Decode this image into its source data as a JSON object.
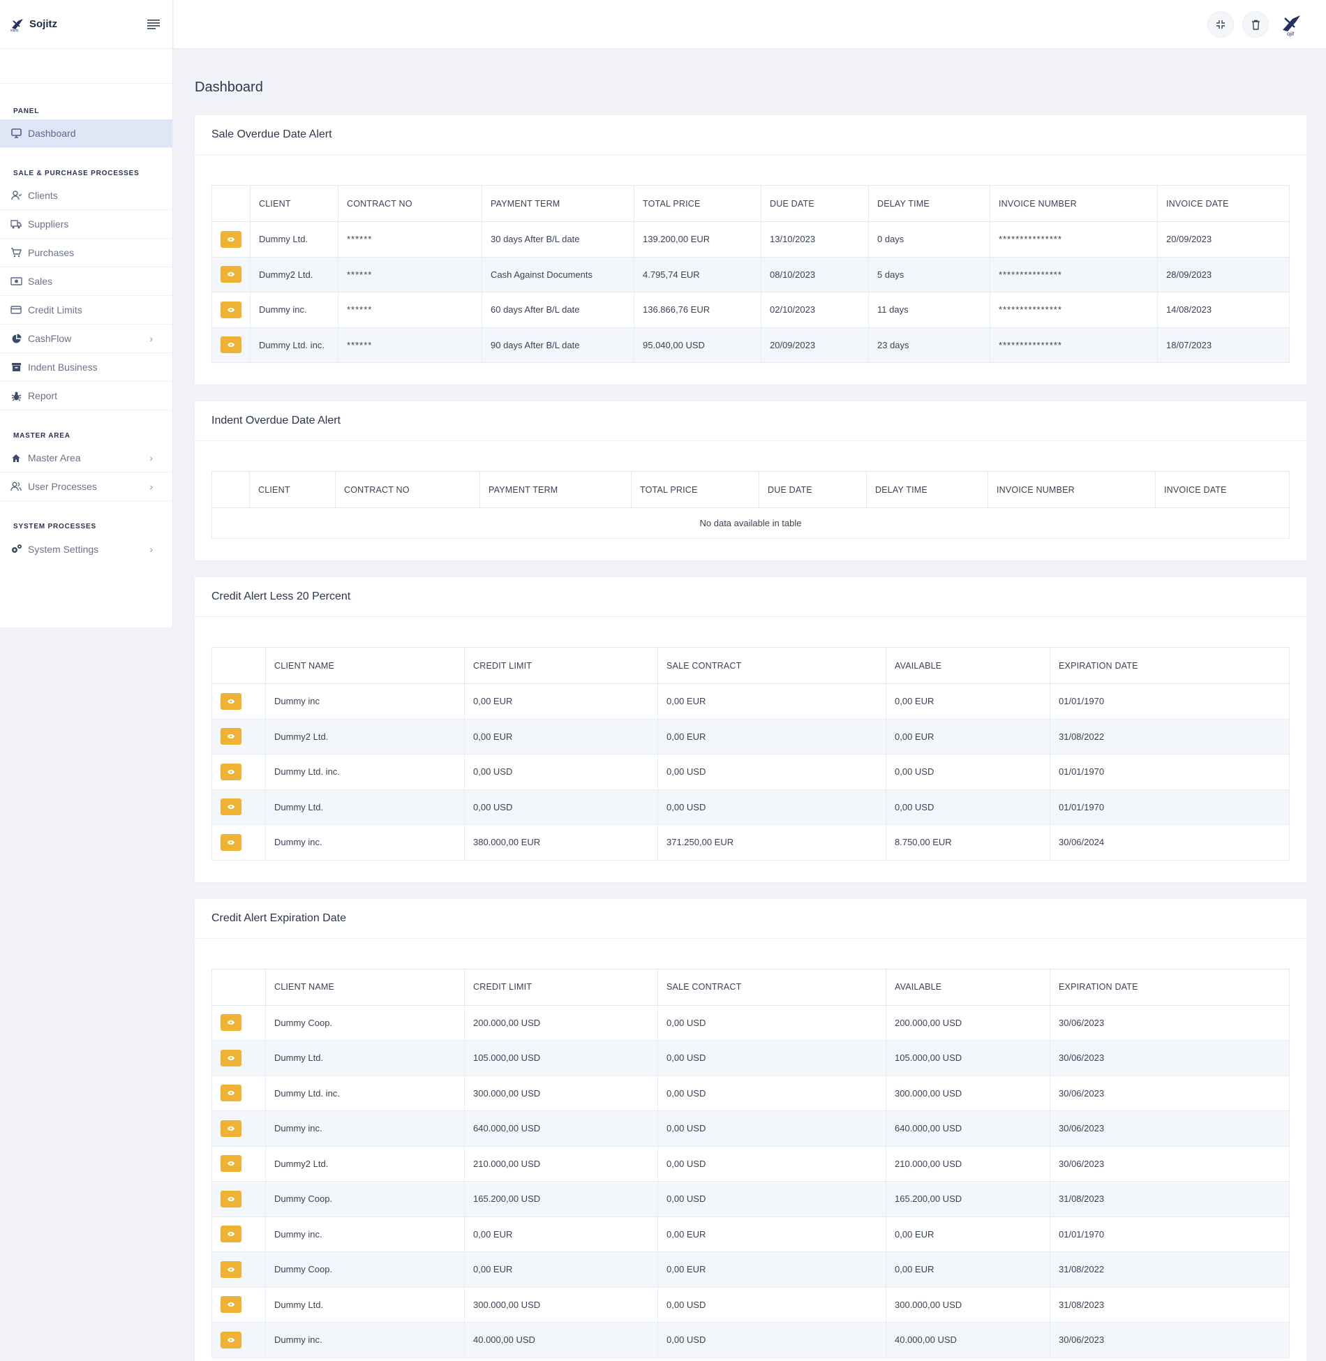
{
  "brand": {
    "name": "Sojitz"
  },
  "sidebar": {
    "sections": [
      {
        "title": "PANEL",
        "items": [
          {
            "label": "Dashboard",
            "icon": "monitor-icon",
            "active": true
          }
        ]
      },
      {
        "title": "SALE & PURCHASE PROCESSES",
        "items": [
          {
            "label": "Clients",
            "icon": "user-icon"
          },
          {
            "label": "Suppliers",
            "icon": "truck-icon"
          },
          {
            "label": "Purchases",
            "icon": "cart-icon"
          },
          {
            "label": "Sales",
            "icon": "money-icon"
          },
          {
            "label": "Credit Limits",
            "icon": "credit-card-icon"
          },
          {
            "label": "CashFlow",
            "icon": "pie-chart-icon",
            "chevron": true
          },
          {
            "label": "Indent Business",
            "icon": "archive-icon"
          },
          {
            "label": "Report",
            "icon": "bug-icon"
          }
        ]
      },
      {
        "title": "MASTER AREA",
        "items": [
          {
            "label": "Master Area",
            "icon": "home-icon",
            "chevron": true
          },
          {
            "label": "User Processes",
            "icon": "users-icon",
            "chevron": true
          }
        ]
      },
      {
        "title": "SYSTEM PROCESSES",
        "items": [
          {
            "label": "System Settings",
            "icon": "gears-icon",
            "chevron": true
          }
        ]
      }
    ]
  },
  "page": {
    "title": "Dashboard"
  },
  "sale_overdue": {
    "title": "Sale Overdue Date Alert",
    "columns": [
      "CLIENT",
      "CONTRACT NO",
      "PAYMENT TERM",
      "TOTAL PRICE",
      "DUE DATE",
      "DELAY TIME",
      "INVOICE NUMBER",
      "INVOICE DATE"
    ],
    "rows": [
      [
        "Dummy Ltd.",
        "******",
        "30 days After B/L date",
        "139.200,00 EUR",
        "13/10/2023",
        "0 days",
        "***************",
        "20/09/2023"
      ],
      [
        "Dummy2 Ltd.",
        "******",
        "Cash Against Documents",
        "4.795,74 EUR",
        "08/10/2023",
        "5 days",
        "***************",
        "28/09/2023"
      ],
      [
        "Dummy inc.",
        "******",
        "60 days After B/L date",
        "136.866,76 EUR",
        "02/10/2023",
        "11 days",
        "***************",
        "14/08/2023"
      ],
      [
        "Dummy Ltd. inc.",
        "******",
        "90 days After B/L date",
        "95.040,00 USD",
        "20/09/2023",
        "23 days",
        "***************",
        "18/07/2023"
      ]
    ]
  },
  "indent_overdue": {
    "title": "Indent Overdue Date Alert",
    "columns": [
      "CLIENT",
      "CONTRACT NO",
      "PAYMENT TERM",
      "TOTAL PRICE",
      "DUE DATE",
      "DELAY TIME",
      "INVOICE NUMBER",
      "INVOICE DATE"
    ],
    "empty_text": "No data available in table"
  },
  "credit_less": {
    "title": "Credit Alert Less 20 Percent",
    "columns": [
      "CLIENT NAME",
      "CREDIT LIMIT",
      "SALE CONTRACT",
      "AVAILABLE",
      "EXPIRATION DATE"
    ],
    "rows": [
      [
        "Dummy inc",
        "0,00 EUR",
        "0,00 EUR",
        "0,00 EUR",
        "01/01/1970"
      ],
      [
        "Dummy2 Ltd.",
        "0,00 EUR",
        "0,00 EUR",
        "0,00 EUR",
        "31/08/2022"
      ],
      [
        "Dummy Ltd. inc.",
        "0,00 USD",
        "0,00 USD",
        "0,00 USD",
        "01/01/1970"
      ],
      [
        "Dummy Ltd.",
        "0,00 USD",
        "0,00 USD",
        "0,00 USD",
        "01/01/1970"
      ],
      [
        "Dummy inc.",
        "380.000,00 EUR",
        "371.250,00 EUR",
        "8.750,00 EUR",
        "30/06/2024"
      ]
    ]
  },
  "credit_exp": {
    "title": "Credit Alert Expiration Date",
    "columns": [
      "CLIENT NAME",
      "CREDIT LIMIT",
      "SALE CONTRACT",
      "AVAILABLE",
      "EXPIRATION DATE"
    ],
    "rows": [
      [
        "Dummy Coop.",
        "200.000,00 USD",
        "0,00 USD",
        "200.000,00 USD",
        "30/06/2023"
      ],
      [
        "Dummy Ltd.",
        "105.000,00 USD",
        "0,00 USD",
        "105.000,00 USD",
        "30/06/2023"
      ],
      [
        "Dummy Ltd. inc.",
        "300.000,00 USD",
        "0,00 USD",
        "300.000,00 USD",
        "30/06/2023"
      ],
      [
        "Dummy inc.",
        "640.000,00 USD",
        "0,00 USD",
        "640.000,00 USD",
        "30/06/2023"
      ],
      [
        "Dummy2 Ltd.",
        "210.000,00 USD",
        "0,00 USD",
        "210.000,00 USD",
        "30/06/2023"
      ],
      [
        "Dummy Coop.",
        "165.200,00 USD",
        "0,00 USD",
        "165.200,00 USD",
        "31/08/2023"
      ],
      [
        "Dummy inc.",
        "0,00 EUR",
        "0,00 EUR",
        "0,00 EUR",
        "01/01/1970"
      ],
      [
        "Dummy Coop.",
        "0,00 EUR",
        "0,00 EUR",
        "0,00 EUR",
        "31/08/2022"
      ],
      [
        "Dummy Ltd.",
        "300.000,00 USD",
        "0,00 USD",
        "300.000,00 USD",
        "31/08/2023"
      ],
      [
        "Dummy inc.",
        "40.000,00 USD",
        "0,00 USD",
        "40.000,00 USD",
        "30/06/2023"
      ]
    ]
  },
  "colors": {
    "accent": "#eeb234",
    "active_nav": "#dfe6f5",
    "background": "#f1f3f9"
  }
}
